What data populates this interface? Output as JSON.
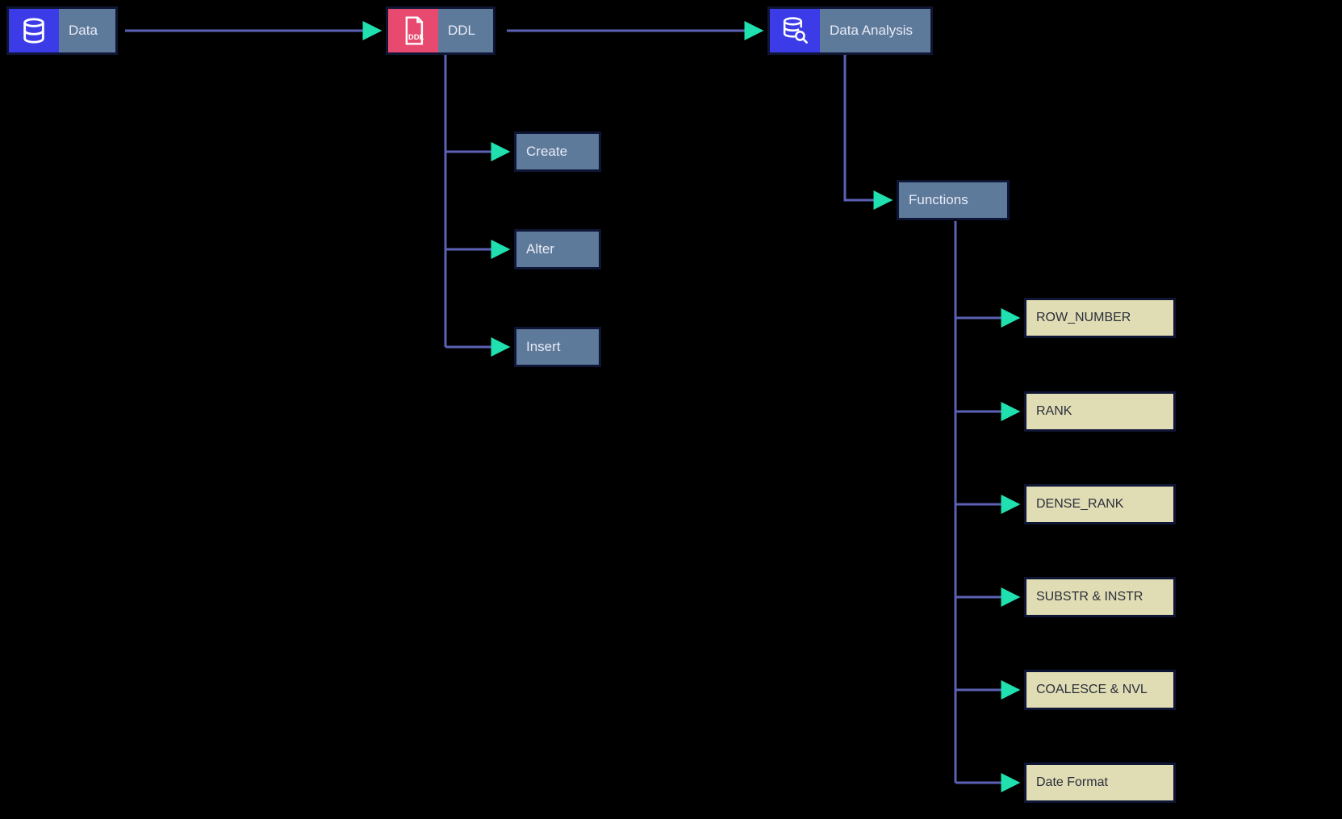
{
  "nodes": {
    "data": {
      "label": "Data"
    },
    "ddl": {
      "label": "DDL"
    },
    "analysis": {
      "label": "Data Analysis"
    },
    "ddl_children": {
      "create": "Create",
      "alter": "Alter",
      "insert": "Insert"
    },
    "functions_head": {
      "label": "Functions"
    },
    "functions": {
      "row_number": "ROW_NUMBER",
      "rank": "RANK",
      "dense_rank": "DENSE_RANK",
      "substr_instr": "SUBSTR & INSTR",
      "coalesce_nvl": "COALESCE & NVL",
      "date_format": "Date Format"
    }
  },
  "colors": {
    "node_border": "#0f1635",
    "node_fill_blue": "#5e7a9b",
    "node_fill_tan": "#e0dcb4",
    "icon_blue": "#3b3be8",
    "icon_red": "#e84a6f",
    "edge_line": "#5b61b3",
    "edge_arrow": "#1fe0ae"
  }
}
